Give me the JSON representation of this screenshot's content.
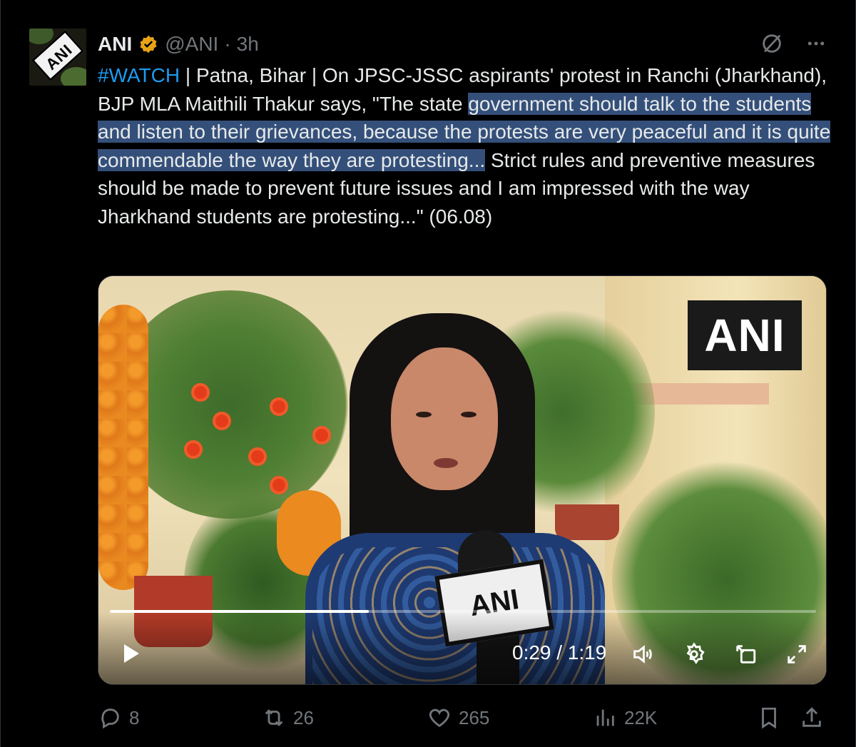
{
  "tweet": {
    "author_name": "ANI",
    "handle": "@ANI",
    "separator": "·",
    "time": "3h",
    "avatar_text": "ANI",
    "text": {
      "hashtag": "#WATCH",
      "part1": " | Patna, Bihar | On JPSC-JSSC aspirants' protest in Ranchi (Jharkhand), BJP MLA Maithili Thakur says, \"The state ",
      "highlighted": "government should talk to the students and listen to their grievances, because the protests are very peaceful and it is quite commendable the way they are protesting...",
      "part2": " Strict rules and preventive measures should be made to prevent future issues and I am impressed with the way Jharkhand students are protesting...\" (06.08)"
    }
  },
  "video": {
    "watermark": "ANI",
    "mic_flag": "ANI",
    "current_time": "0:29",
    "duration": "1:19",
    "time_display": "0:29 / 1:19",
    "progress_fraction": 0.367
  },
  "actions": {
    "replies": "8",
    "reposts": "26",
    "likes": "265",
    "views": "22K"
  },
  "colors": {
    "accent": "#1d9bf0",
    "muted": "#71767b",
    "highlight": "#34507a",
    "verified": "#e8a317"
  },
  "icons": [
    "verified-badge-icon",
    "grok-icon",
    "more-icon",
    "play-icon",
    "volume-icon",
    "settings-icon",
    "pip-icon",
    "fullscreen-icon",
    "reply-icon",
    "repost-icon",
    "like-icon",
    "views-icon",
    "bookmark-icon",
    "share-icon"
  ]
}
